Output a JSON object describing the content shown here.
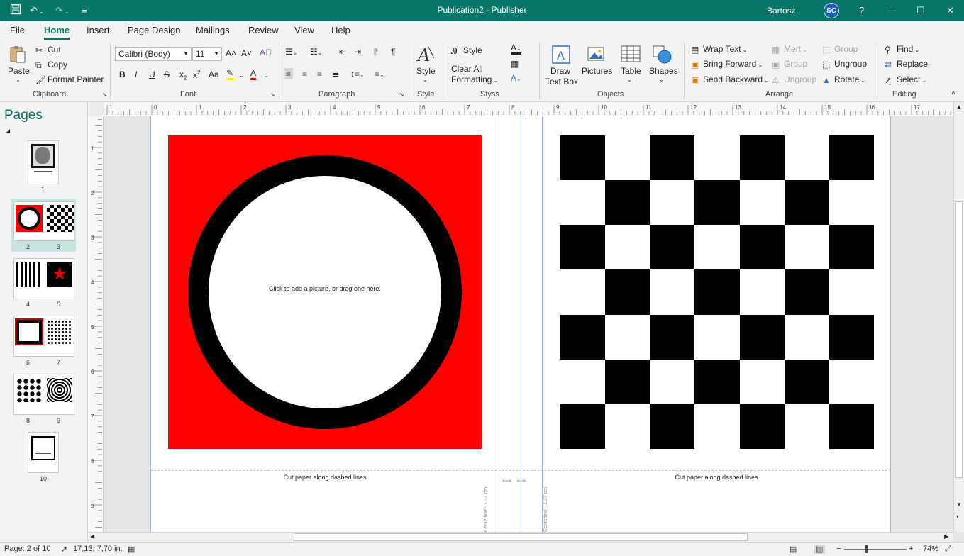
{
  "window": {
    "title": "Publication2  -  Publisher",
    "user": "Bartosz",
    "user_initials": "SC",
    "help": "?"
  },
  "menu": {
    "tabs": [
      "File",
      "Home",
      "Insert",
      "Page Design",
      "Mailings",
      "Review",
      "View",
      "Help"
    ],
    "active": "Home"
  },
  "ribbon": {
    "clipboard": {
      "paste": "Paste",
      "cut": "Cut",
      "copy": "Copy",
      "format_painter": "Format Painter",
      "label": "Clipboard"
    },
    "font": {
      "name": "Calibri (Body)",
      "size": "11",
      "bold": "B",
      "italic": "I",
      "underline": "U",
      "strike": "S",
      "label": "Font"
    },
    "paragraph": {
      "label": "Paragraph"
    },
    "style": {
      "style": "Style",
      "label": "Style"
    },
    "styles": {
      "style": "Style",
      "clear_all": "Clear All",
      "formatting": "Formatting",
      "label": "Styss"
    },
    "objects": {
      "draw_text_box_1": "Draw",
      "draw_text_box_2": "Text Box",
      "pictures": "Pictures",
      "table": "Table",
      "shapes": "Shapes",
      "label": "Objects"
    },
    "arrange": {
      "wrap_text": "Wrap Text",
      "bring_forward": "Bring Forward",
      "send_backward": "Send Backward",
      "merge": "Mert",
      "group_dis": "Group",
      "ungroup_dis": "Ungroup",
      "group": "Group",
      "ungroup": "Ungroup",
      "rotate": "Rotate",
      "label": "Arrange"
    },
    "editing": {
      "find": "Find",
      "replace": "Replace",
      "select": "Select",
      "label": "Editing"
    }
  },
  "pages_panel": {
    "title": "Pages",
    "thumbs": [
      {
        "label": "1"
      },
      {
        "label_a": "2",
        "label_b": "3"
      },
      {
        "label_a": "4",
        "label_b": "5"
      },
      {
        "label_a": "6",
        "label_b": "7"
      },
      {
        "label_a": "8",
        "label_b": "9"
      },
      {
        "label": "10"
      }
    ]
  },
  "ruler": {
    "h_ticks": [
      "1",
      "0",
      "1",
      "2",
      "3",
      "4",
      "5",
      "6",
      "7",
      "8",
      "9",
      "10",
      "11",
      "12",
      "13",
      "14",
      "15",
      "16",
      "17",
      "18"
    ],
    "v_ticks": [
      "1",
      "2",
      "3",
      "4",
      "5",
      "6",
      "7",
      "8",
      "9"
    ]
  },
  "document": {
    "placeholder": "Click to add a picture, or drag one here.",
    "cut_note": "Cut paper along dashed lines",
    "gutter_note": "Centerline - 1.37 cm",
    "colors": {
      "red": "#ff0000",
      "black": "#000000"
    }
  },
  "status": {
    "page": "Page: 2 of 10",
    "coords": "17,13; 7,70 in.",
    "zoom": "74%"
  }
}
